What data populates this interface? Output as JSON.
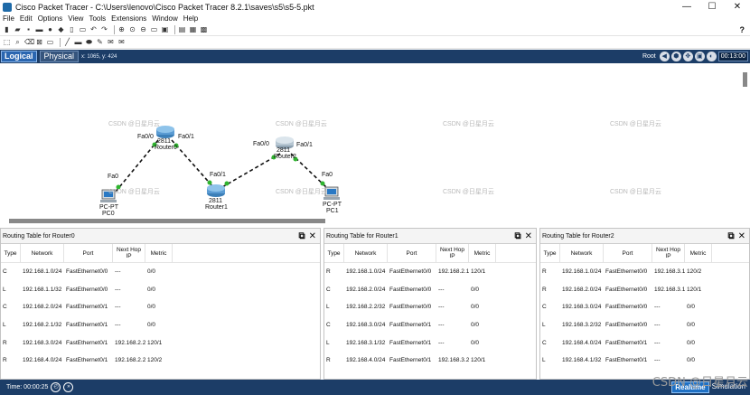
{
  "window": {
    "title": "Cisco Packet Tracer - C:\\Users\\lenovo\\Cisco Packet Tracer 8.2.1\\saves\\s5\\s5-5.pkt",
    "min": "—",
    "max": "☐",
    "close": "✕"
  },
  "menu": [
    "File",
    "Edit",
    "Options",
    "View",
    "Tools",
    "Extensions",
    "Window",
    "Help"
  ],
  "toolbar": {
    "help": "?"
  },
  "modebar": {
    "logical": "Logical",
    "physical": "Physical",
    "coords": "x: 1065, y: 424",
    "root": "Root",
    "clock": "00:13:00"
  },
  "watermark": "CSDN @日星月云",
  "topology": {
    "router0": {
      "model": "2811",
      "name": "Router0",
      "ports": [
        "Fa0/0",
        "Fa0/1"
      ]
    },
    "router1": {
      "model": "2811",
      "name": "Router1",
      "ports": [
        "Fa0/1",
        "Fa0/0"
      ]
    },
    "router2": {
      "model": "2811",
      "name": "Router2",
      "ports": [
        "Fa0/0",
        "Fa0/1"
      ]
    },
    "pc0": {
      "model": "PC-PT",
      "name": "PC0",
      "port": "Fa0"
    },
    "pc1": {
      "model": "PC-PT",
      "name": "PC1",
      "port": "Fa0"
    }
  },
  "table_headers": {
    "type": "Type",
    "network": "Network",
    "port": "Port",
    "nexthop": "Next Hop IP",
    "metric": "Metric"
  },
  "tables": [
    {
      "title": "Routing Table for Router0",
      "rows": [
        [
          "C",
          "192.168.1.0/24",
          "FastEthernet0/0",
          "---",
          "0/0"
        ],
        [
          "L",
          "192.168.1.1/32",
          "FastEthernet0/0",
          "---",
          "0/0"
        ],
        [
          "C",
          "192.168.2.0/24",
          "FastEthernet0/1",
          "---",
          "0/0"
        ],
        [
          "L",
          "192.168.2.1/32",
          "FastEthernet0/1",
          "---",
          "0/0"
        ],
        [
          "R",
          "192.168.3.0/24",
          "FastEthernet0/1",
          "192.168.2.2",
          "120/1"
        ],
        [
          "R",
          "192.168.4.0/24",
          "FastEthernet0/1",
          "192.168.2.2",
          "120/2"
        ]
      ]
    },
    {
      "title": "Routing Table for Router1",
      "rows": [
        [
          "R",
          "192.168.1.0/24",
          "FastEthernet0/0",
          "192.168.2.1",
          "120/1"
        ],
        [
          "C",
          "192.168.2.0/24",
          "FastEthernet0/0",
          "---",
          "0/0"
        ],
        [
          "L",
          "192.168.2.2/32",
          "FastEthernet0/0",
          "---",
          "0/0"
        ],
        [
          "C",
          "192.168.3.0/24",
          "FastEthernet0/1",
          "---",
          "0/0"
        ],
        [
          "L",
          "192.168.3.1/32",
          "FastEthernet0/1",
          "---",
          "0/0"
        ],
        [
          "R",
          "192.168.4.0/24",
          "FastEthernet0/1",
          "192.168.3.2",
          "120/1"
        ]
      ]
    },
    {
      "title": "Routing Table for Router2",
      "rows": [
        [
          "R",
          "192.168.1.0/24",
          "FastEthernet0/0",
          "192.168.3.1",
          "120/2"
        ],
        [
          "R",
          "192.168.2.0/24",
          "FastEthernet0/0",
          "192.168.3.1",
          "120/1"
        ],
        [
          "C",
          "192.168.3.0/24",
          "FastEthernet0/0",
          "---",
          "0/0"
        ],
        [
          "L",
          "192.168.3.2/32",
          "FastEthernet0/0",
          "---",
          "0/0"
        ],
        [
          "C",
          "192.168.4.0/24",
          "FastEthernet0/1",
          "---",
          "0/0"
        ],
        [
          "L",
          "192.168.4.1/32",
          "FastEthernet0/1",
          "---",
          "0/0"
        ]
      ]
    }
  ],
  "status": {
    "time": "Time: 00:00:25",
    "realtime": "Realtime",
    "simulation": "Simulation",
    "corner_watermark": "CSDN @日星月云"
  }
}
